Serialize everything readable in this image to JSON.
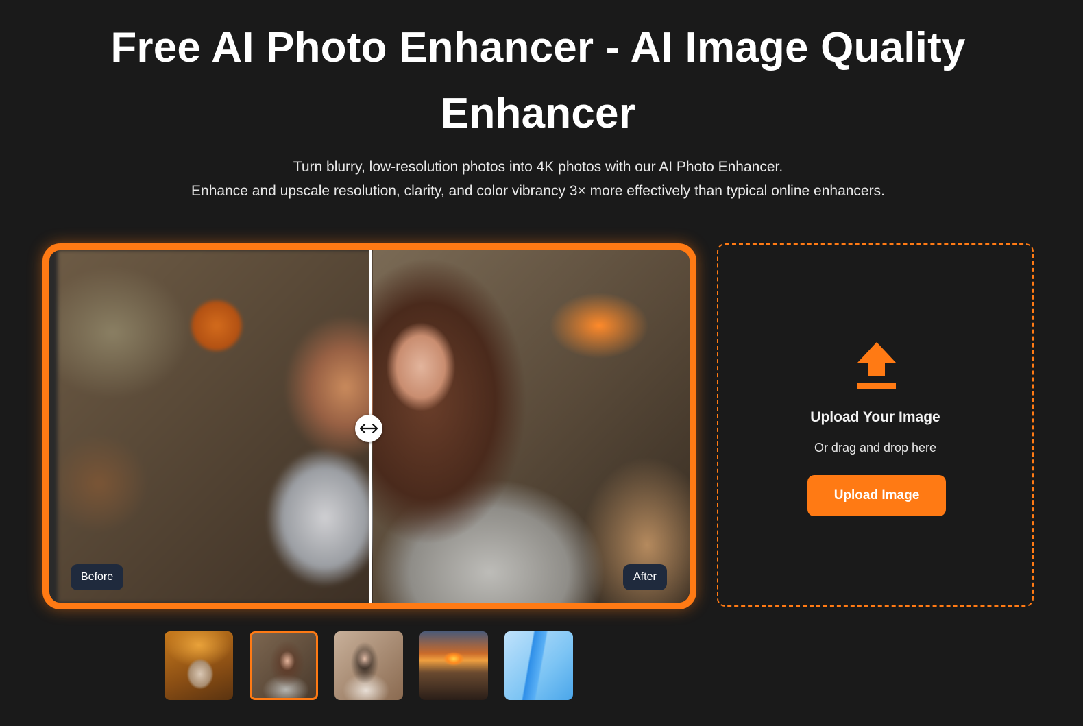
{
  "hero": {
    "title": "Free AI Photo Enhancer - AI Image Quality Enhancer",
    "subtitle_line1": "Turn blurry, low-resolution photos into 4K photos with our AI Photo Enhancer.",
    "subtitle_line2": "Enhance and upscale resolution, clarity, and color vibrancy 3× more effectively than typical online enhancers."
  },
  "compare": {
    "before_label": "Before",
    "after_label": "After",
    "handle_icon": "double-arrow-horizontal-icon",
    "split_position": 0.5
  },
  "upload": {
    "icon": "upload-arrow-icon",
    "title": "Upload Your Image",
    "hint": "Or drag and drop here",
    "button_label": "Upload Image"
  },
  "samples": {
    "selected_index": 1,
    "items": [
      "rabbit-sample",
      "woman-coffee-sample",
      "woman-portrait-sample",
      "sunset-landscape-sample",
      "blue-phone-sample"
    ]
  },
  "colors": {
    "accent": "#ff7a14",
    "background": "#1a1a1a",
    "tag_background": "#1f2a3d"
  }
}
